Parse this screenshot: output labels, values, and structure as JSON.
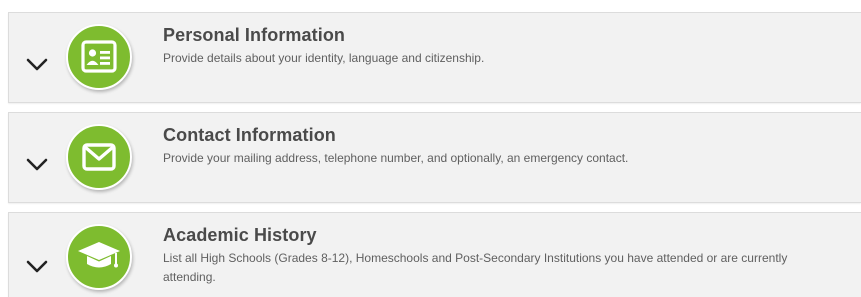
{
  "sections": [
    {
      "title": "Personal Information",
      "description": "Provide details about your identity, language and citizenship.",
      "icon": "id-card-icon"
    },
    {
      "title": "Contact Information",
      "description": "Provide your mailing address, telephone number, and optionally, an emergency contact.",
      "icon": "envelope-icon"
    },
    {
      "title": "Academic History",
      "description": "List all High Schools (Grades 8-12), Homeschools and Post-Secondary Institutions you have attended or are currently attending.",
      "icon": "graduation-cap-icon"
    }
  ],
  "colors": {
    "accent_green": "#7ebc2f",
    "panel_bg": "#f2f2f2",
    "title_text": "#4a4a4a",
    "body_text": "#606060"
  }
}
